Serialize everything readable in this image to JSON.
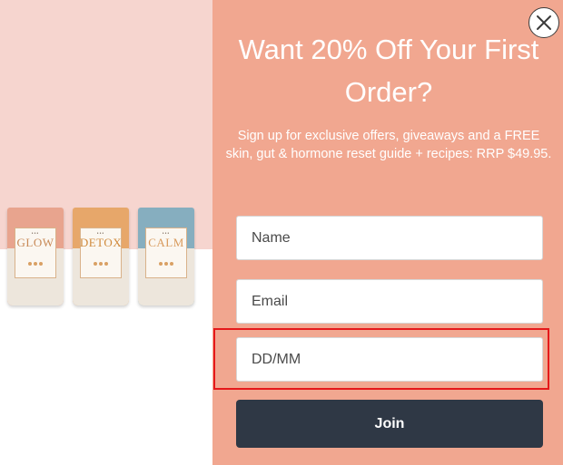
{
  "popup": {
    "headline": "Want 20% Off Your First Order?",
    "subtext": "Sign up for exclusive offers, giveaways and a FREE skin, gut & hormone reset guide + recipes: RRP $49.95.",
    "fields": {
      "name_placeholder": "Name",
      "email_placeholder": "Email",
      "dob_placeholder": "DD/MM"
    },
    "submit_label": "Join",
    "colors": {
      "panel": "#f1a790",
      "left_background": "#f6d5cf",
      "button": "#2f3845",
      "highlight": "#e5191b"
    }
  },
  "products": [
    {
      "name": "GLOW",
      "top_color": "#e8a48e",
      "text_color": "#c88a57"
    },
    {
      "name": "DETOX",
      "top_color": "#e7a76a",
      "text_color": "#d08a3c"
    },
    {
      "name": "CALM",
      "top_color": "#86aebf",
      "text_color": "#d89a5c"
    }
  ],
  "icons": {
    "close": "close-icon"
  }
}
